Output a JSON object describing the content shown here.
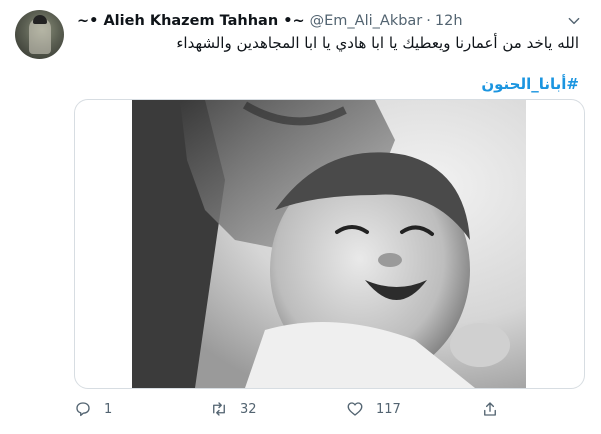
{
  "tweet": {
    "author_name": "~• Alieh Khazem Tahhan •~",
    "handle": "@Em_Ali_Akbar",
    "separator": "·",
    "time": "12h",
    "text": "الله ياخد من أعمارنا ويعطيك يا ابا هادي يا ابا المجاهدين والشهداء",
    "hashtag": "#أبانا_الحنون"
  },
  "actions": {
    "reply_count": "1",
    "retweet_count": "32",
    "like_count": "117"
  },
  "icons": {
    "more": "chevron-down-icon",
    "reply": "reply-icon",
    "retweet": "retweet-icon",
    "like": "heart-icon",
    "share": "share-icon"
  },
  "colors": {
    "hashtag": "#1b95e0",
    "muted": "#536471"
  }
}
